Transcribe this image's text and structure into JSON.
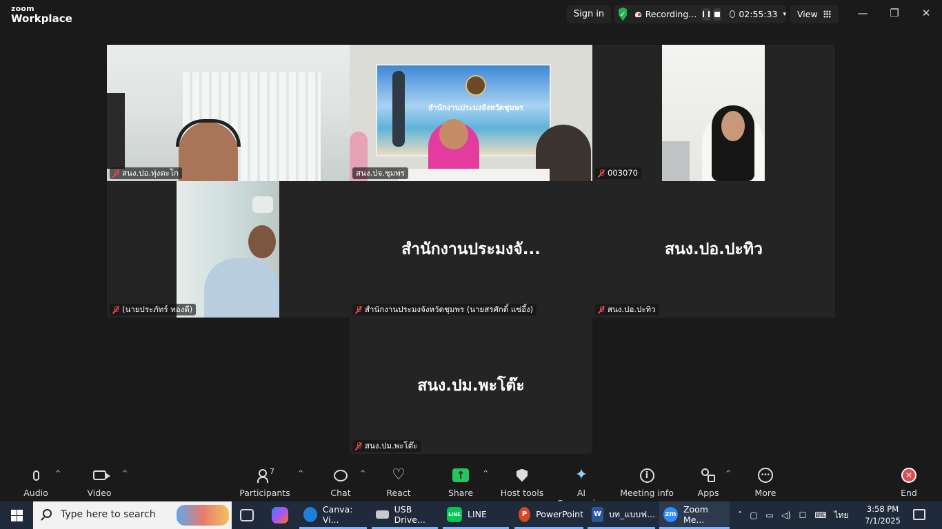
{
  "titlebar": {
    "brand_small": "zoom",
    "brand_big": "Workplace",
    "signin": "Sign in",
    "security_check": "✓",
    "recording_label": "Recording...",
    "timer": "02:55:33",
    "view_label": "View",
    "window_controls": {
      "minimize": "—",
      "restore": "❐",
      "close": "✕"
    }
  },
  "tiles": [
    {
      "name": "สนง.ปอ.ทุ่งตะโก",
      "muted": true,
      "video": true
    },
    {
      "name": "สนง.ปจ.ชุมพร",
      "muted": false,
      "video": true,
      "active_speaker": true,
      "banner_text": "สำนักงานประมงจังหวัดชุมพร"
    },
    {
      "name": "003070",
      "muted": true,
      "video": true
    },
    {
      "name": "(นายประภัทร์ ทองดี)",
      "muted": true,
      "video": true
    },
    {
      "name": "สำนักงานประมงจังหวัดชุมพร (นายสรศักดิ์ แซ่อึ้ง)",
      "display": "สำนักงานประมงจั...",
      "muted": true,
      "video": false
    },
    {
      "name": "สนง.ปอ.ปะทิว",
      "display": "สนง.ปอ.ปะทิว",
      "muted": true,
      "video": false
    },
    {
      "name": "สนง.ปม.พะโต๊ะ",
      "display": "สนง.ปม.พะโต๊ะ",
      "muted": true,
      "video": false
    }
  ],
  "toolbar": {
    "audio": "Audio",
    "video": "Video",
    "participants": "Participants",
    "participants_count": "7",
    "chat": "Chat",
    "react": "React",
    "share": "Share",
    "host_tools": "Host tools",
    "ai_companion": "AI Companion",
    "meeting_info": "Meeting info",
    "apps": "Apps",
    "more": "More",
    "end": "End",
    "caret": "^"
  },
  "taskbar": {
    "search_placeholder": "Type here to search",
    "apps": [
      {
        "label": "Canva: Vi...",
        "icon": "edge-icon",
        "color": "#1e7fd8"
      },
      {
        "label": "USB Drive...",
        "icon": "usb-drive-icon",
        "color": "#c9c9c9"
      },
      {
        "label": "LINE",
        "icon": "line-icon",
        "color": "#06c755"
      },
      {
        "label": "PowerPoint",
        "icon": "powerpoint-icon",
        "color": "#d24726"
      },
      {
        "label": "บท_แบบฟ...",
        "icon": "word-icon",
        "color": "#2b579a"
      },
      {
        "label": "Zoom Me...",
        "icon": "zoom-icon",
        "color": "#2d8cff"
      }
    ],
    "language": "ไทย",
    "time": "3:58 PM",
    "date": "7/1/2025"
  }
}
